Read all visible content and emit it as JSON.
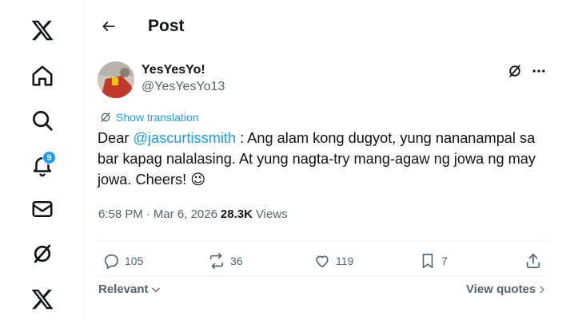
{
  "header": {
    "title": "Post"
  },
  "sidebar": {
    "items": [
      {
        "name": "x-logo-icon"
      },
      {
        "name": "home-icon"
      },
      {
        "name": "search-icon"
      },
      {
        "name": "notifications-icon",
        "badge": "9"
      },
      {
        "name": "messages-icon"
      },
      {
        "name": "grok-icon"
      },
      {
        "name": "x-premium-icon"
      }
    ]
  },
  "post": {
    "display_name": "YesYesYo!",
    "handle": "@YesYesYo13",
    "show_translation": "Show translation",
    "text_prefix": "Dear ",
    "mention": "@jascurtissmith",
    "text_body": " : Ang alam kong dugyot, yung nananampal sa bar kapag nalalasing. At yung nagta-try mang-agaw ng jowa ng may jowa. Cheers! ",
    "emoji": "😉",
    "time": "6:58 PM",
    "separator": "·",
    "date": "Mar 6, 2026",
    "views_count": "28.3K",
    "views_label": "Views"
  },
  "actions": {
    "replies": "105",
    "reposts": "36",
    "likes": "119",
    "bookmarks": "7"
  },
  "footer": {
    "sort_label": "Relevant",
    "view_quotes": "View quotes"
  },
  "colors": {
    "accent": "#1d9bf0",
    "text": "#0f1419",
    "secondary": "#536471",
    "divider": "#eff3f4"
  }
}
